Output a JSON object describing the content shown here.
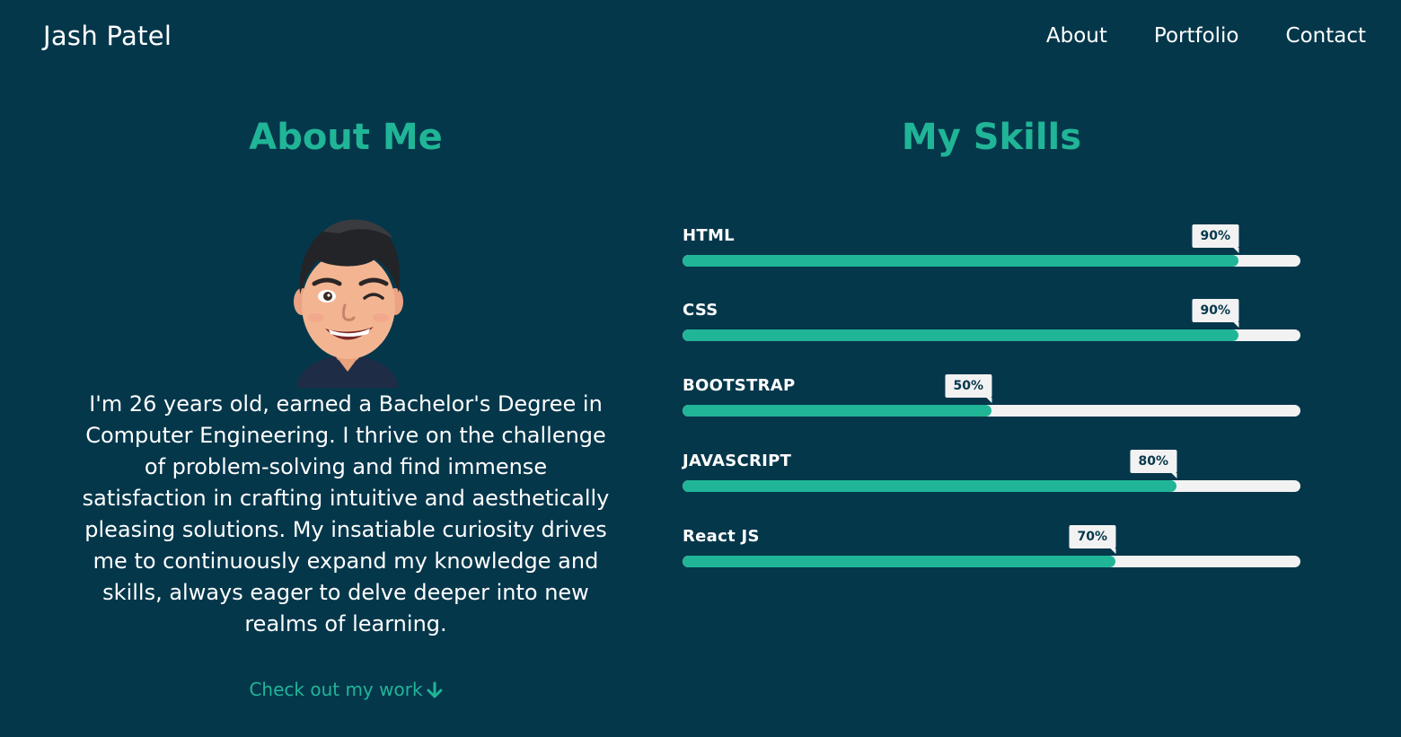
{
  "navbar": {
    "brand": "Jash Patel",
    "links": [
      {
        "label": "About"
      },
      {
        "label": "Portfolio"
      },
      {
        "label": "Contact"
      }
    ]
  },
  "about": {
    "title": "About Me",
    "description": "I'm 26 years old, earned a Bachelor's Degree in Computer Engineering. I thrive on the challenge of problem-solving and find immense satisfaction in crafting intuitive and aesthetically pleasing solutions. My insatiable curiosity drives me to continuously expand my knowledge and skills, always eager to delve deeper into new realms of learning.",
    "cta_label": "Check out my work",
    "cta_icon": "arrow-down-icon"
  },
  "skills": {
    "title": "My Skills",
    "items": [
      {
        "name": "HTML",
        "percent": 90,
        "percent_label": "90%"
      },
      {
        "name": "CSS",
        "percent": 90,
        "percent_label": "90%"
      },
      {
        "name": "BOOTSTRAP",
        "percent": 50,
        "percent_label": "50%"
      },
      {
        "name": "JAVASCRIPT",
        "percent": 80,
        "percent_label": "80%"
      },
      {
        "name": "React JS",
        "percent": 70,
        "percent_label": "70%"
      }
    ]
  },
  "colors": {
    "background": "#05374b",
    "accent": "#20b597",
    "track": "#f2f2f2",
    "text": "#ffffff"
  }
}
